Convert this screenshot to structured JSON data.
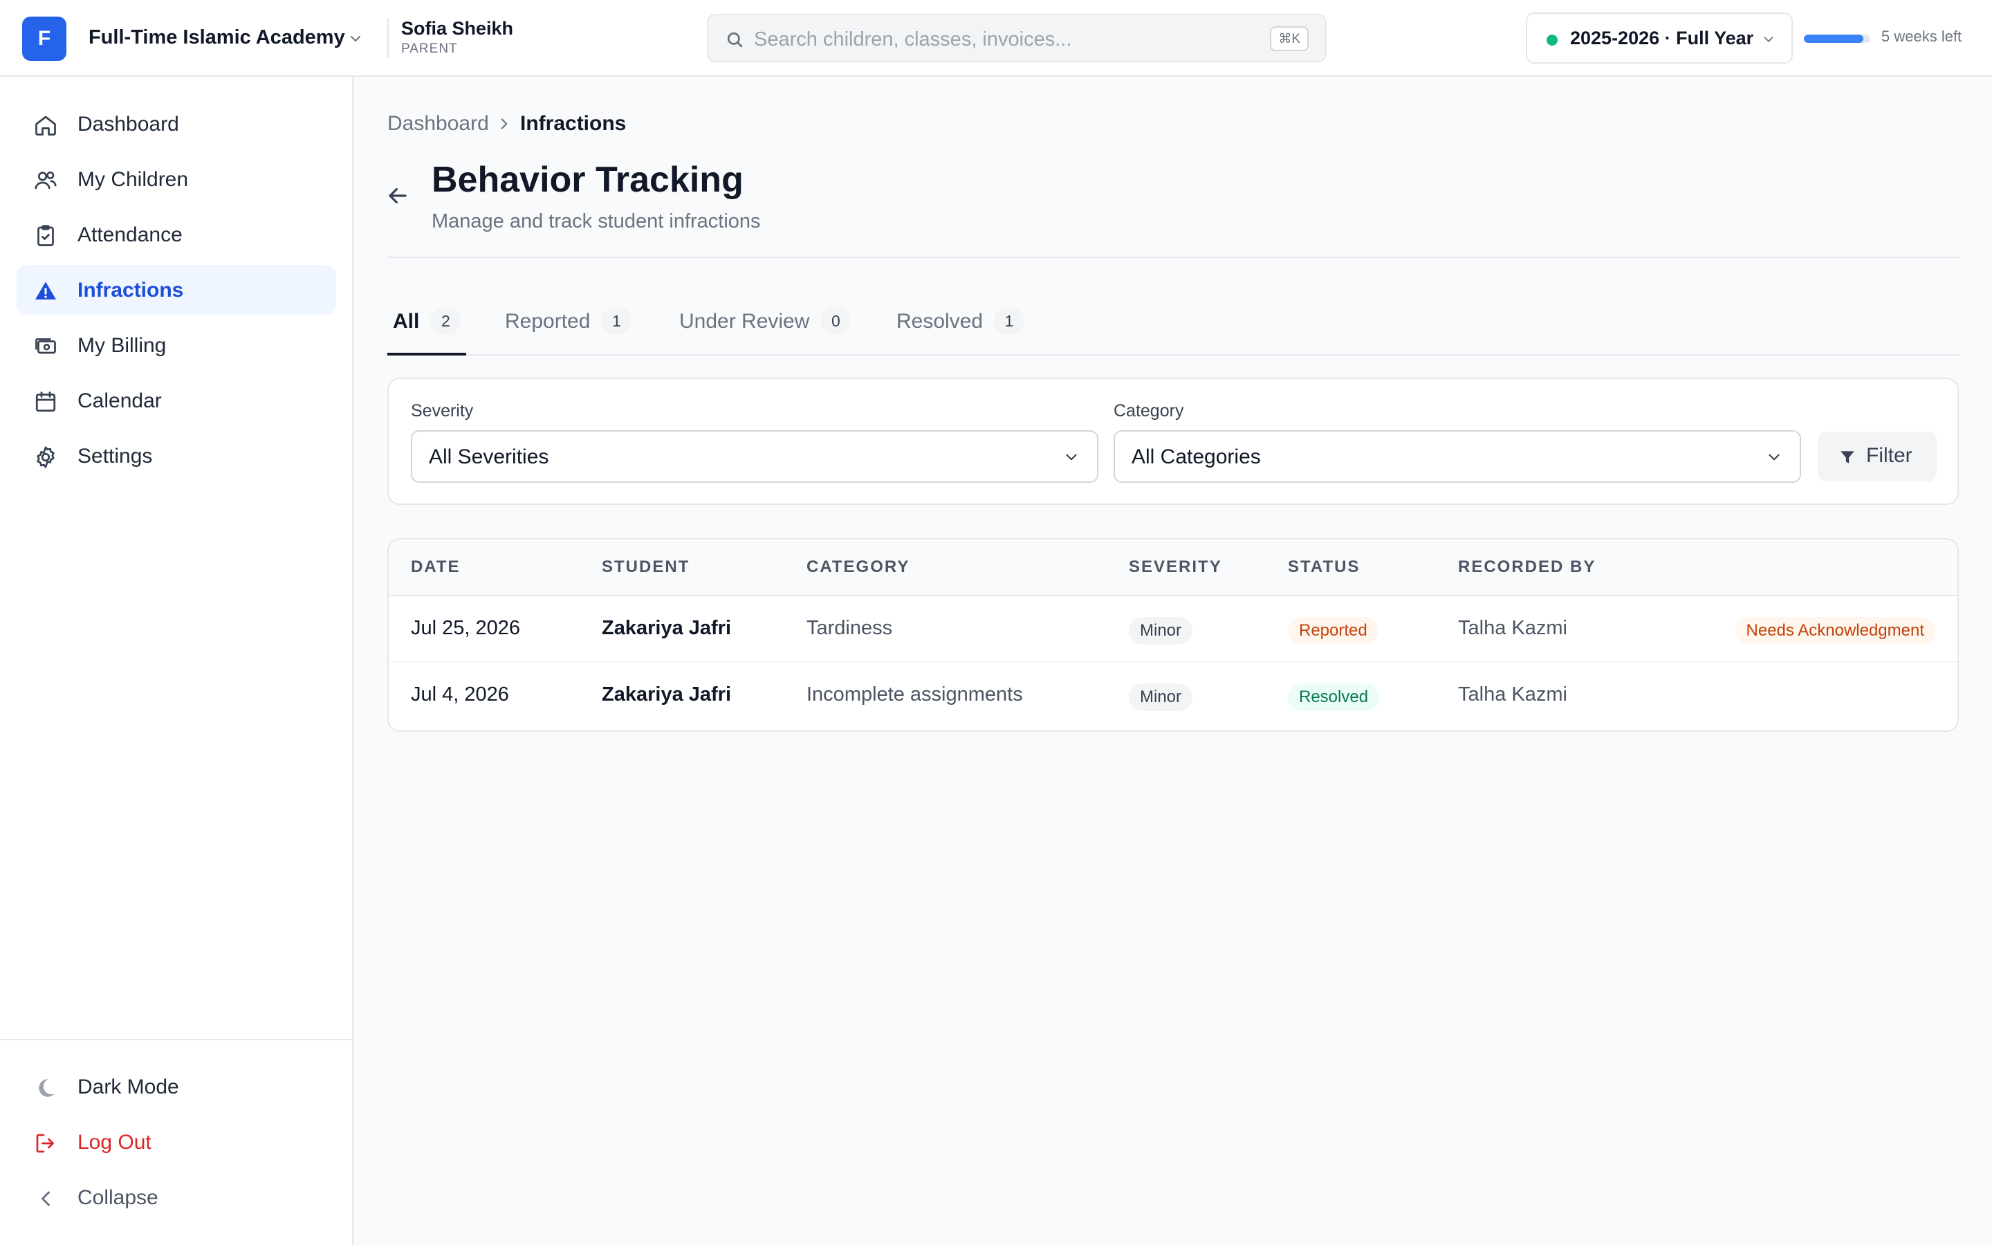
{
  "org": {
    "initial": "F",
    "name": "Full-Time Islamic Academy"
  },
  "user": {
    "name": "Sofia Sheikh",
    "role": "PARENT"
  },
  "search": {
    "placeholder": "Search children, classes, invoices...",
    "shortcut": "⌘K"
  },
  "academic_year": {
    "label": "2025-2026 · Full Year",
    "weeks_left": "5 weeks left",
    "progress": 0.9,
    "status_color": "#10b981"
  },
  "sidebar": {
    "items": [
      {
        "label": "Dashboard",
        "icon": "home-icon"
      },
      {
        "label": "My Children",
        "icon": "users-icon"
      },
      {
        "label": "Attendance",
        "icon": "clipboard-check-icon"
      },
      {
        "label": "Infractions",
        "icon": "alert-triangle-icon",
        "active": true
      },
      {
        "label": "My Billing",
        "icon": "billing-icon"
      },
      {
        "label": "Calendar",
        "icon": "calendar-icon"
      },
      {
        "label": "Settings",
        "icon": "gear-icon"
      }
    ],
    "bottom": {
      "dark_mode": "Dark Mode",
      "logout": "Log Out",
      "collapse": "Collapse"
    }
  },
  "breadcrumb": {
    "parent": "Dashboard",
    "current": "Infractions"
  },
  "page": {
    "title": "Behavior Tracking",
    "subtitle": "Manage and track student infractions"
  },
  "tabs": [
    {
      "label": "All",
      "count": "2",
      "active": true
    },
    {
      "label": "Reported",
      "count": "1"
    },
    {
      "label": "Under Review",
      "count": "0"
    },
    {
      "label": "Resolved",
      "count": "1"
    }
  ],
  "filters": {
    "severity_label": "Severity",
    "severity_value": "All Severities",
    "category_label": "Category",
    "category_value": "All Categories",
    "filter_button": "Filter"
  },
  "table": {
    "headers": [
      "DATE",
      "STUDENT",
      "CATEGORY",
      "SEVERITY",
      "STATUS",
      "RECORDED BY"
    ],
    "rows": [
      {
        "date": "Jul 25, 2026",
        "student": "Zakariya Jafri",
        "category": "Tardiness",
        "severity": "Minor",
        "status": "Reported",
        "recorded_by": "Talha Kazmi",
        "action": "Needs Acknowledgment"
      },
      {
        "date": "Jul 4, 2026",
        "student": "Zakariya Jafri",
        "category": "Incomplete assignments",
        "severity": "Minor",
        "status": "Resolved",
        "recorded_by": "Talha Kazmi",
        "action": ""
      }
    ]
  },
  "colors": {
    "accent": "#2563eb",
    "active_bg": "#eff6ff",
    "danger": "#dc2626"
  }
}
